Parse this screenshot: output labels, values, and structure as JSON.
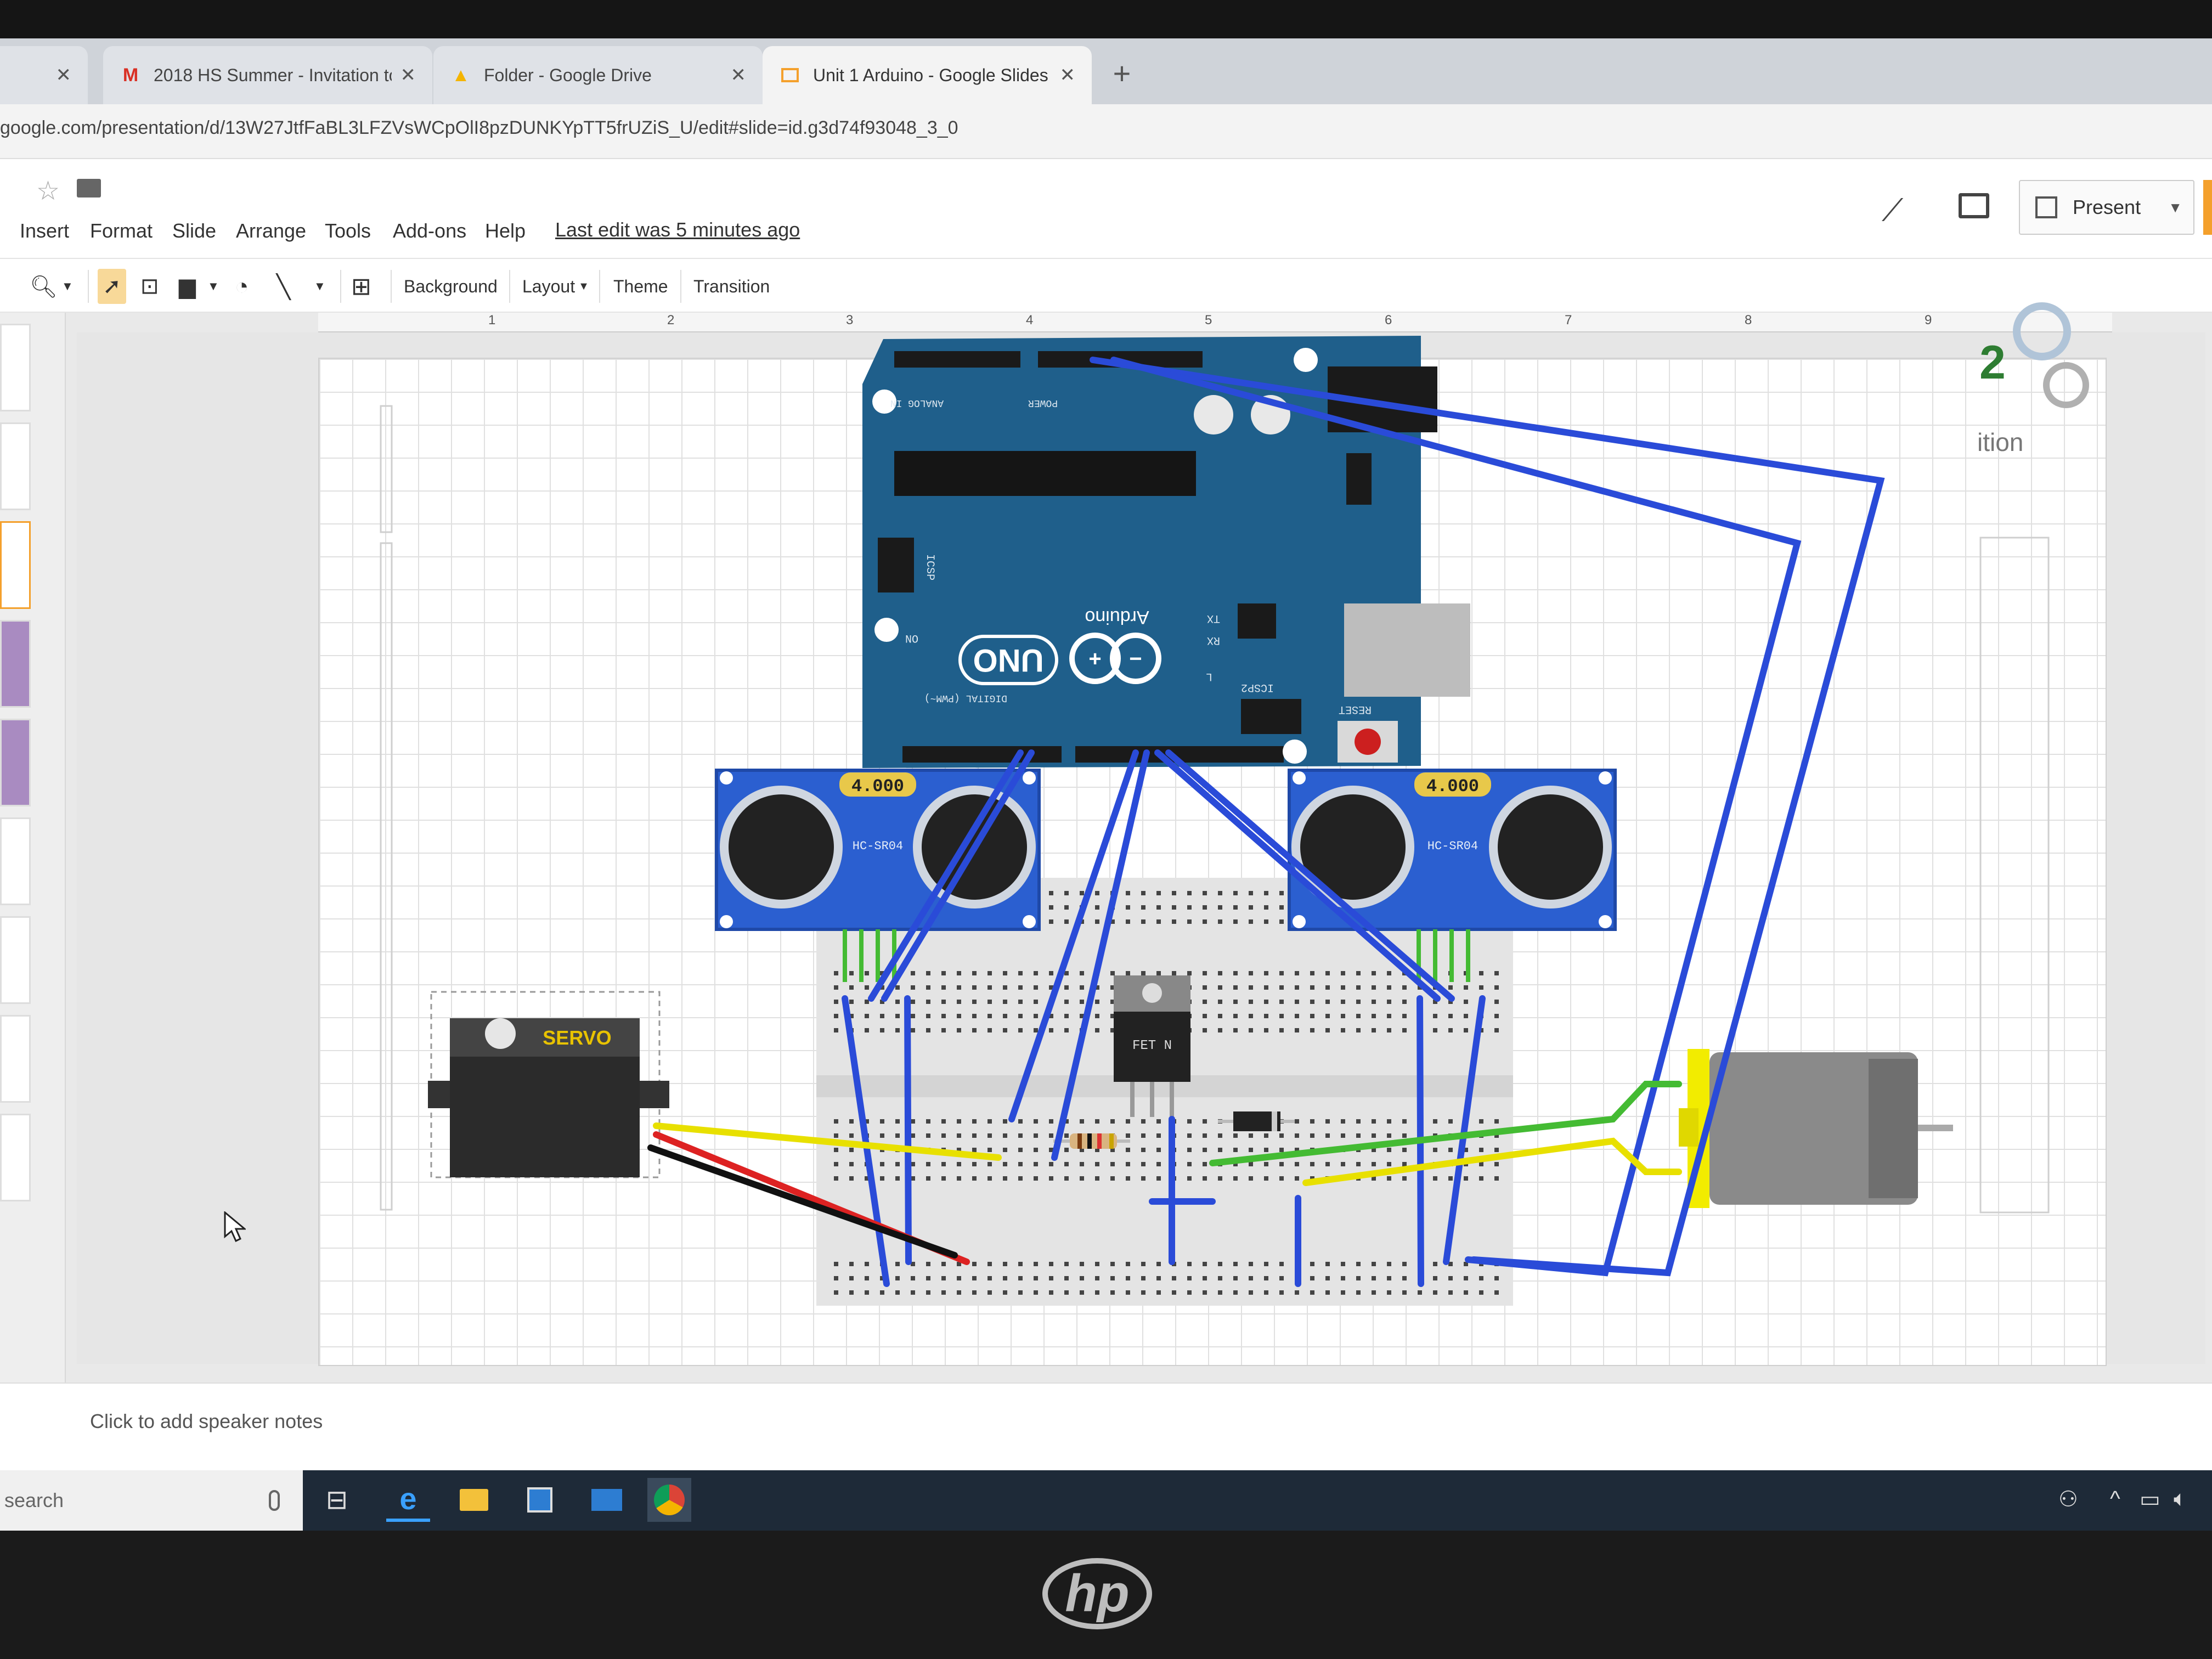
{
  "browser": {
    "tabs": [
      {
        "label": "2018 HS Summer - Invitation to …",
        "icon": "gmail-icon"
      },
      {
        "label": "Folder - Google Drive",
        "icon": "drive-icon"
      },
      {
        "label": "Unit 1 Arduino - Google Slides",
        "icon": "slides-icon",
        "active": true
      }
    ],
    "new_tab": "+",
    "url": "google.com/presentation/d/13W27JtfFaBL3LFZVsWCpOlI8pzDUNKYpTT5frUZiS_U/edit#slide=id.g3d74f93048_3_0"
  },
  "app": {
    "menus": [
      "Insert",
      "Format",
      "Slide",
      "Arrange",
      "Tools",
      "Add-ons",
      "Help"
    ],
    "last_edit": "Last edit was 5 minutes ago",
    "present_label": "Present"
  },
  "toolbar": {
    "background_label": "Background",
    "layout_label": "Layout",
    "theme_label": "Theme",
    "transition_label": "Transition"
  },
  "ruler": {
    "marks": [
      "1",
      "2",
      "3",
      "4",
      "5",
      "6",
      "7",
      "8",
      "9"
    ]
  },
  "slide": {
    "arduino_brand": "Arduino",
    "arduino_model": "UNO",
    "sensor_left_value": "4.000",
    "sensor_right_value": "4.000",
    "sensor_left_label": "HC-SR04",
    "sensor_right_label": "HC-SR04",
    "servo_label": "SERVO",
    "fet_label": "FET N",
    "side_text_number": "2",
    "side_text_word": "ition",
    "pin_labels": {
      "analog": "ANALOG IN",
      "power": "POWER",
      "digital": "DIGITAL (PWM~)",
      "icsp": "ICSP",
      "icsp2": "ICSP2",
      "reset": "RESET",
      "tx": "TX",
      "rx": "RX",
      "on": "ON",
      "l": "L"
    }
  },
  "notes": {
    "placeholder": "Click to add speaker notes"
  },
  "taskbar": {
    "search_placeholder": "search"
  },
  "colors": {
    "arduino_board": "#1f5f8b",
    "wire_blue": "#2a4bd8",
    "wire_green": "#44bb33",
    "wire_yellow": "#e8e000",
    "wire_red": "#dd2222",
    "motor_yellow": "#f2ec00"
  }
}
